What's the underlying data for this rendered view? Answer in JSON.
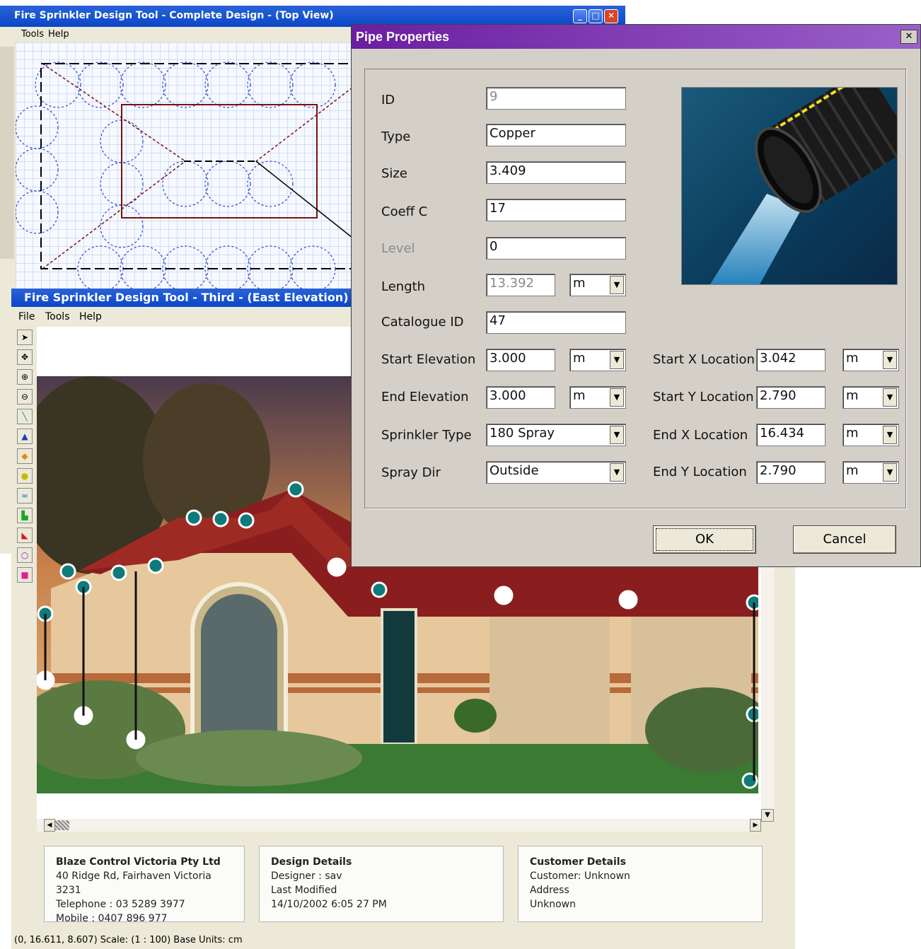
{
  "top_window": {
    "title": "Fire Sprinkler Design Tool - Complete Design - (Top View)",
    "menu": [
      "Tools",
      "Help"
    ]
  },
  "east_window": {
    "title": "Fire Sprinkler Design Tool - Third - (East Elevation)",
    "menu": [
      "File",
      "Tools",
      "Help"
    ],
    "tools": [
      "pointer-icon",
      "pan-icon",
      "zoom-in-icon",
      "zoom-out-icon",
      "pipe-icon",
      "sprinkler-icon",
      "valve-icon",
      "junction-icon",
      "wave-icon",
      "elbow-icon",
      "reducer-icon",
      "circle-icon",
      "rectangle-icon"
    ],
    "status_bar": "(0, 16.611, 8.607)   Scale: (1 : 100)   Base Units:  cm",
    "company": {
      "heading": "Blaze Control Victoria Pty Ltd",
      "line1": "40 Ridge Rd, Fairhaven Victoria 3231",
      "line2": "Telephone : 03 5289 3977",
      "line3": "Mobile : 0407 896 977"
    },
    "design": {
      "heading": "Design Details",
      "line1": "Designer :  sav",
      "line2": "Last Modified",
      "line3": "14/10/2002 6:05 27 PM"
    },
    "customer": {
      "heading": "Customer Details",
      "line1": "Customer:  Unknown",
      "line2": "Address",
      "line3": "Unknown"
    }
  },
  "dialog": {
    "title": "Pipe Properties",
    "close": "✕",
    "labels": {
      "id": "ID",
      "type": "Type",
      "size": "Size",
      "coeff": "Coeff C",
      "level": "Level",
      "length": "Length",
      "catalogue": "Catalogue ID",
      "start_elev": "Start Elevation",
      "end_elev": "End Elevation",
      "sprinkler_type": "Sprinkler Type",
      "spray_dir": "Spray Dir",
      "start_x": "Start X Location",
      "start_y": "Start Y Location",
      "end_x": "End X Location",
      "end_y": "End Y Location"
    },
    "values": {
      "id": "9",
      "type": "Copper",
      "size": "3.409",
      "coeff": "17",
      "level": "0",
      "length": "13.392",
      "catalogue": "47",
      "start_elev": "3.000",
      "end_elev": "3.000",
      "sprinkler_type": "180 Spray",
      "spray_dir": "Outside",
      "start_x": "3.042",
      "start_y": "2.790",
      "end_x": "16.434",
      "end_y": "2.790"
    },
    "unit": "m",
    "ok": "OK",
    "cancel": "Cancel"
  }
}
